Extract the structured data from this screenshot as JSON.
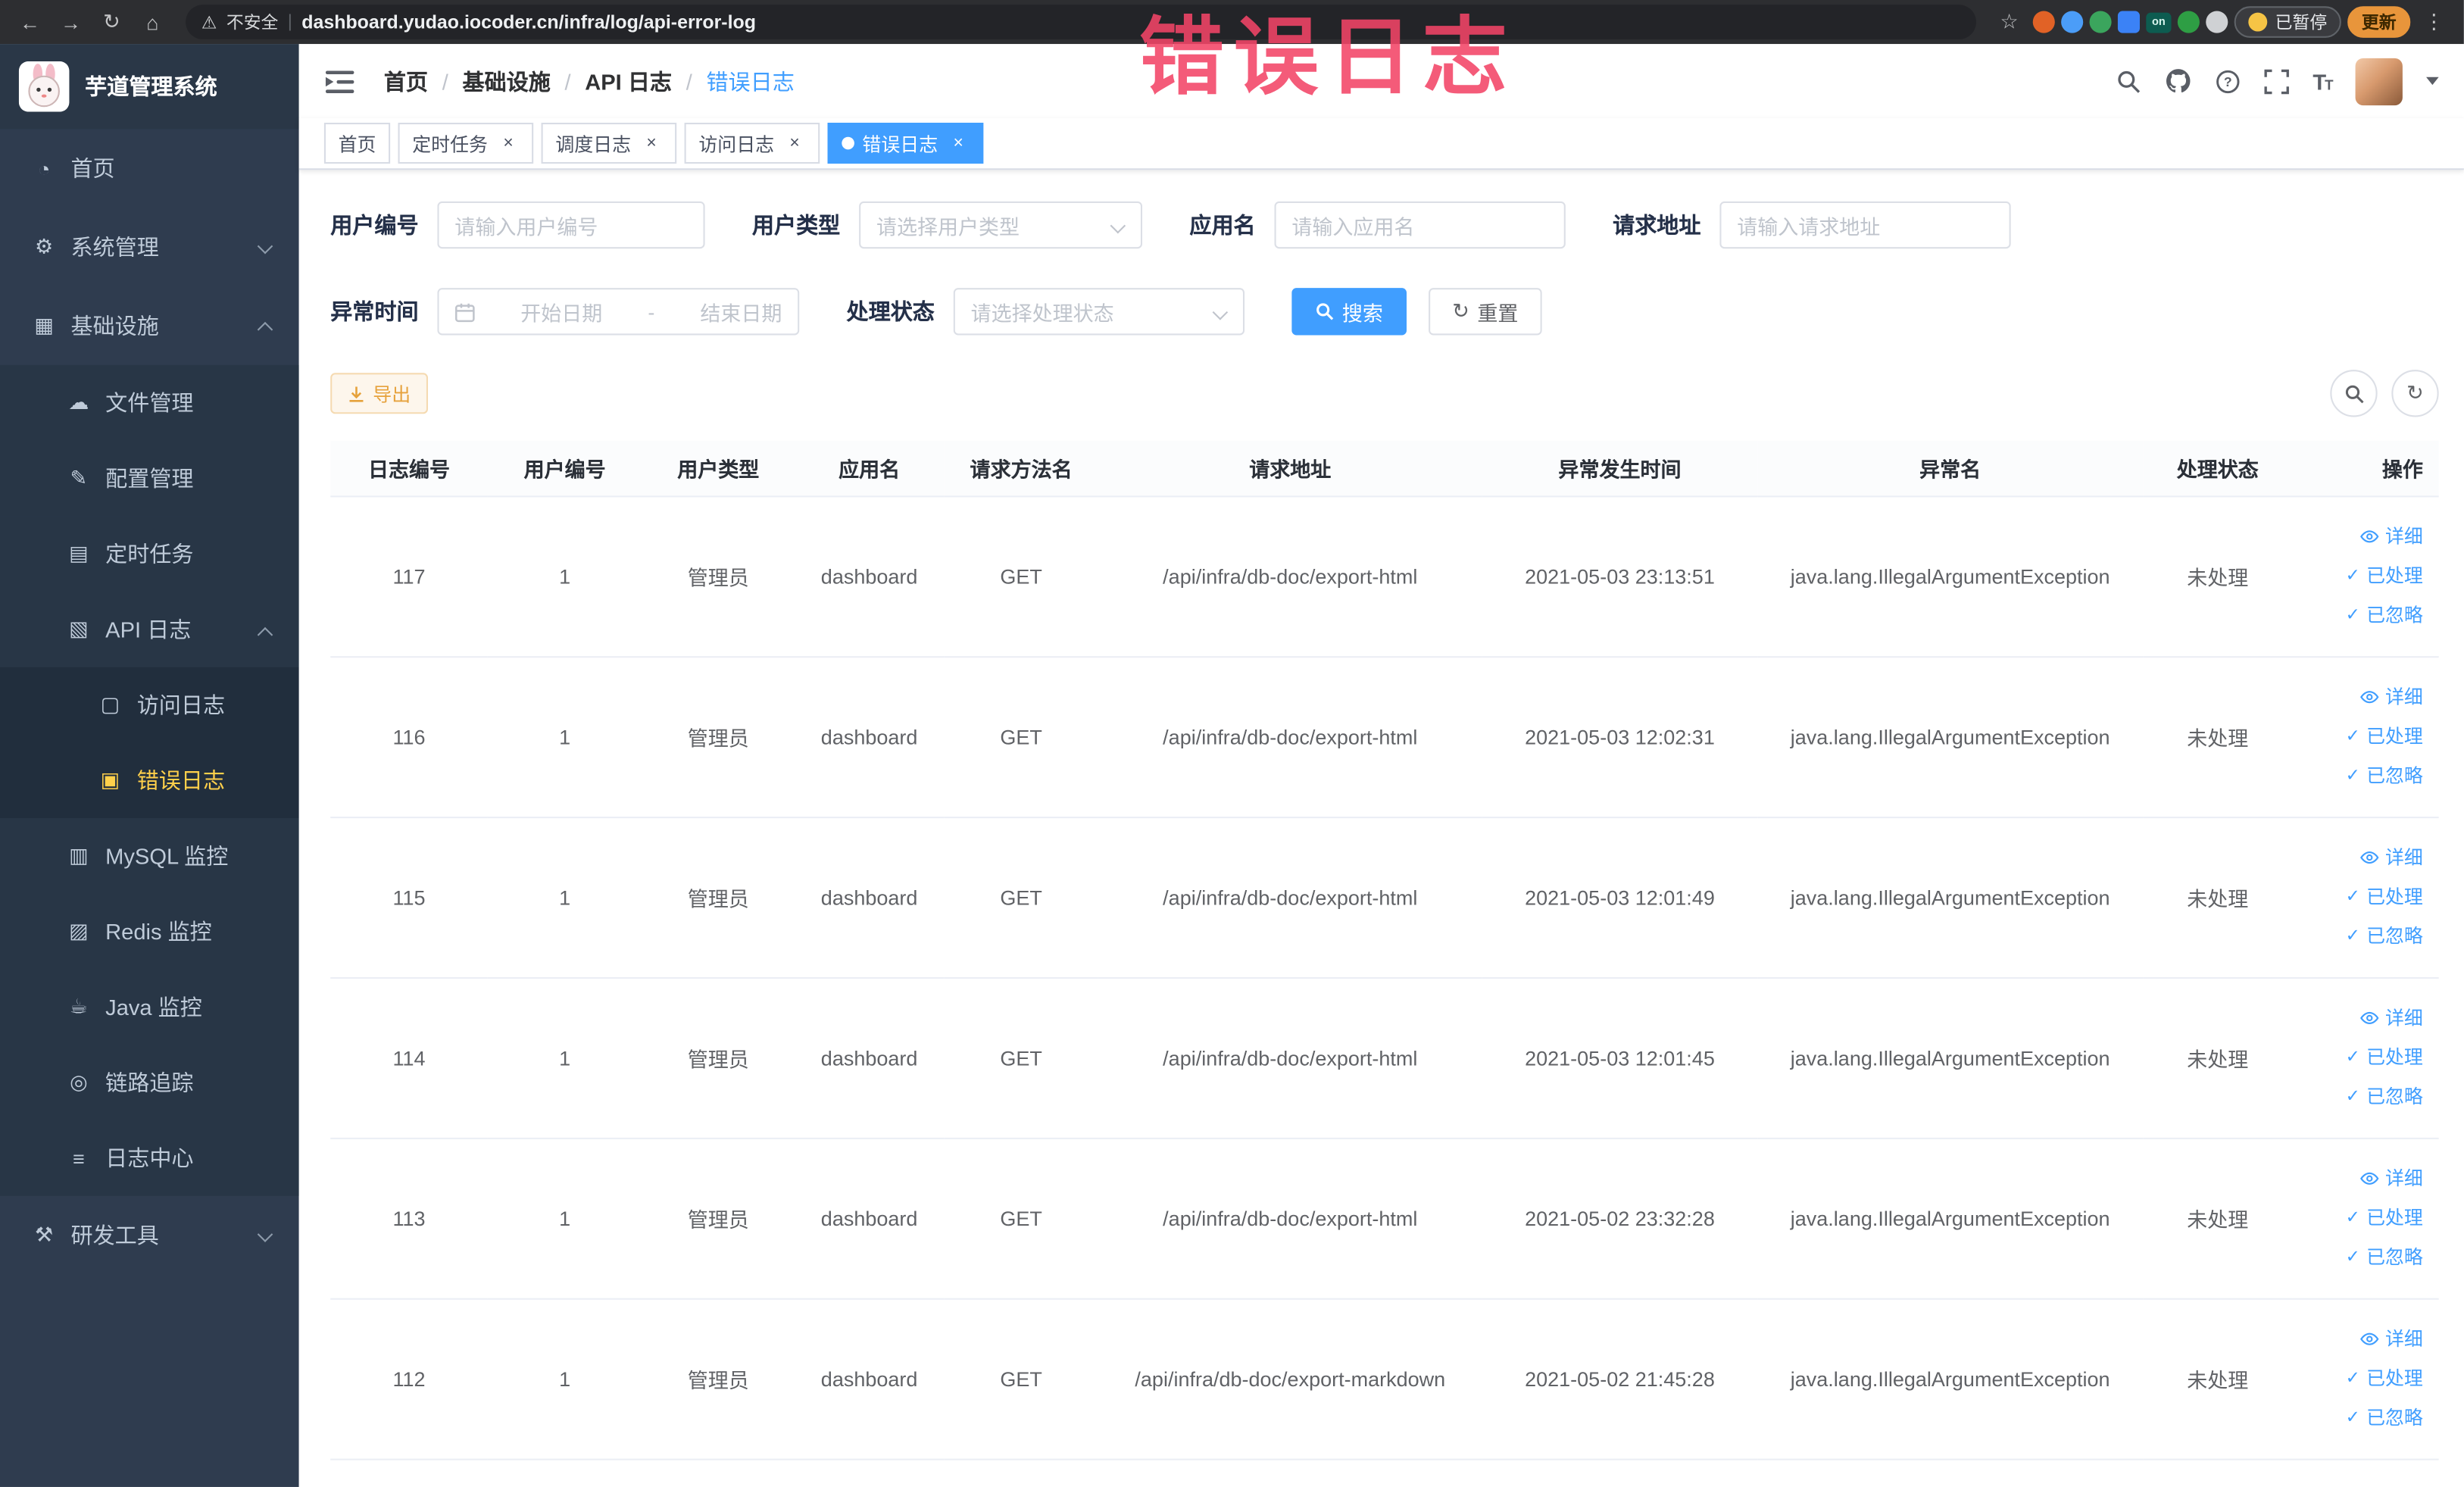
{
  "browser": {
    "security_label": "不安全",
    "divider": "|",
    "url": "dashboard.yudao.iocoder.cn/infra/log/api-error-log",
    "paused_label": "已暂停",
    "update_label": "更新"
  },
  "annotation": {
    "text": "错误日志"
  },
  "icons": {
    "back-icon": "←",
    "forward-icon": "→",
    "reload-icon": "↻",
    "home-icon": "⌂",
    "warning-icon": "⚠",
    "star-icon": "☆",
    "kebab-icon": "⋮",
    "close-icon": "×",
    "refresh-icon": "↻",
    "check-icon": "✓",
    "ext-on-badge": "on",
    "dashboard-icon": "◔",
    "gear-icon": "⚙",
    "infra-icon": "▦",
    "file-icon": "☁",
    "config-icon": "✎",
    "job-icon": "▤",
    "api-log-icon": "▧",
    "access-log-icon": "▢",
    "error-log-icon": "▣",
    "mysql-icon": "▥",
    "redis-icon": "▨",
    "java-icon": "☕",
    "trace-icon": "◎",
    "log-center-icon": "≡",
    "devtools-icon": "⚒"
  },
  "sidebar": {
    "logo_title": "芋道管理系统",
    "items": [
      {
        "name": "sidebar-item-home",
        "label": "首页",
        "icon": "dashboard-icon",
        "level": 1
      },
      {
        "name": "sidebar-item-system",
        "label": "系统管理",
        "icon": "gear-icon",
        "level": 1,
        "arrow": "down"
      },
      {
        "name": "sidebar-item-infra",
        "label": "基础设施",
        "icon": "infra-icon",
        "level": 1,
        "arrow": "up"
      },
      {
        "name": "sidebar-item-file",
        "label": "文件管理",
        "icon": "file-icon",
        "level": 2
      },
      {
        "name": "sidebar-item-config",
        "label": "配置管理",
        "icon": "config-icon",
        "level": 2
      },
      {
        "name": "sidebar-item-job",
        "label": "定时任务",
        "icon": "job-icon",
        "level": 2
      },
      {
        "name": "sidebar-item-api-log",
        "label": "API 日志",
        "icon": "api-log-icon",
        "level": 2,
        "arrow": "up"
      },
      {
        "name": "sidebar-item-access-log",
        "label": "访问日志",
        "icon": "access-log-icon",
        "level": 3
      },
      {
        "name": "sidebar-item-error-log",
        "label": "错误日志",
        "icon": "error-log-icon",
        "level": 3,
        "active": true
      },
      {
        "name": "sidebar-item-mysql",
        "label": "MySQL 监控",
        "icon": "mysql-icon",
        "level": 2
      },
      {
        "name": "sidebar-item-redis",
        "label": "Redis 监控",
        "icon": "redis-icon",
        "level": 2
      },
      {
        "name": "sidebar-item-java",
        "label": "Java 监控",
        "icon": "java-icon",
        "level": 2
      },
      {
        "name": "sidebar-item-trace",
        "label": "链路追踪",
        "icon": "trace-icon",
        "level": 2
      },
      {
        "name": "sidebar-item-log-center",
        "label": "日志中心",
        "icon": "log-center-icon",
        "level": 2
      },
      {
        "name": "sidebar-item-devtools",
        "label": "研发工具",
        "icon": "devtools-icon",
        "level": 1,
        "arrow": "down"
      }
    ]
  },
  "breadcrumb": [
    "首页",
    "基础设施",
    "API 日志",
    "错误日志"
  ],
  "breadcrumb_separator": "/",
  "tabs": [
    {
      "name": "tab-home",
      "label": "首页",
      "closable": false,
      "active": false
    },
    {
      "name": "tab-job",
      "label": "定时任务",
      "closable": true,
      "active": false
    },
    {
      "name": "tab-schedule-log",
      "label": "调度日志",
      "closable": true,
      "active": false
    },
    {
      "name": "tab-access-log",
      "label": "访问日志",
      "closable": true,
      "active": false
    },
    {
      "name": "tab-error-log",
      "label": "错误日志",
      "closable": true,
      "active": true
    }
  ],
  "filters": {
    "user_id": {
      "label": "用户编号",
      "placeholder": "请输入用户编号"
    },
    "user_type": {
      "label": "用户类型",
      "placeholder": "请选择用户类型"
    },
    "app_name": {
      "label": "应用名",
      "placeholder": "请输入应用名"
    },
    "request_url": {
      "label": "请求地址",
      "placeholder": "请输入请求地址"
    },
    "exception_time": {
      "label": "异常时间",
      "start_placeholder": "开始日期",
      "separator": "-",
      "end_placeholder": "结束日期"
    },
    "process_status": {
      "label": "处理状态",
      "placeholder": "请选择处理状态"
    },
    "search_button": "搜索",
    "reset_button": "重置"
  },
  "toolbar": {
    "export_button": "导出"
  },
  "table": {
    "columns": [
      "日志编号",
      "用户编号",
      "用户类型",
      "应用名",
      "请求方法名",
      "请求地址",
      "异常发生时间",
      "异常名",
      "处理状态",
      "操作"
    ],
    "actions": [
      "详细",
      "已处理",
      "已忽略"
    ],
    "rows": [
      {
        "id": "117",
        "user_id": "1",
        "user_type": "管理员",
        "app": "dashboard",
        "method": "GET",
        "url": "/api/infra/db-doc/export-html",
        "time": "2021-05-03 23:13:51",
        "exception": "java.lang.IllegalArgumentException",
        "status": "未处理"
      },
      {
        "id": "116",
        "user_id": "1",
        "user_type": "管理员",
        "app": "dashboard",
        "method": "GET",
        "url": "/api/infra/db-doc/export-html",
        "time": "2021-05-03 12:02:31",
        "exception": "java.lang.IllegalArgumentException",
        "status": "未处理"
      },
      {
        "id": "115",
        "user_id": "1",
        "user_type": "管理员",
        "app": "dashboard",
        "method": "GET",
        "url": "/api/infra/db-doc/export-html",
        "time": "2021-05-03 12:01:49",
        "exception": "java.lang.IllegalArgumentException",
        "status": "未处理"
      },
      {
        "id": "114",
        "user_id": "1",
        "user_type": "管理员",
        "app": "dashboard",
        "method": "GET",
        "url": "/api/infra/db-doc/export-html",
        "time": "2021-05-03 12:01:45",
        "exception": "java.lang.IllegalArgumentException",
        "status": "未处理"
      },
      {
        "id": "113",
        "user_id": "1",
        "user_type": "管理员",
        "app": "dashboard",
        "method": "GET",
        "url": "/api/infra/db-doc/export-html",
        "time": "2021-05-02 23:32:28",
        "exception": "java.lang.IllegalArgumentException",
        "status": "未处理"
      },
      {
        "id": "112",
        "user_id": "1",
        "user_type": "管理员",
        "app": "dashboard",
        "method": "GET",
        "url": "/api/infra/db-doc/export-markdown",
        "time": "2021-05-02 21:45:28",
        "exception": "java.lang.IllegalArgumentException",
        "status": "未处理"
      }
    ]
  },
  "colors": {
    "accent": "#409eff",
    "sidebar_active": "#ffd04b",
    "warning": "#e6a23c",
    "annotation": "#f24467"
  }
}
